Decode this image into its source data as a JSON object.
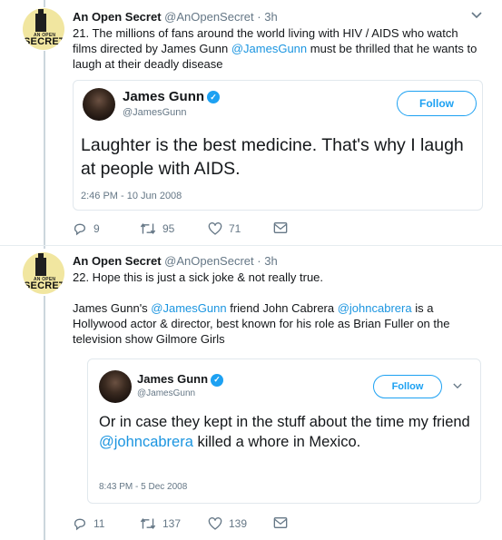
{
  "tweets": [
    {
      "author_name": "An Open Secret",
      "author_handle": "@AnOpenSecret",
      "separator": "·",
      "time": "3h",
      "avatar_subtext": "AN OPEN",
      "avatar_text": "SECRET",
      "text_parts": [
        "21. The millions of fans around the world living with HIV / AIDS who watch films directed by James Gunn ",
        "@JamesGunn",
        " must be thrilled that he wants to laugh at their deadly disease"
      ],
      "quote": {
        "name": "James Gunn",
        "handle": "@JamesGunn",
        "follow_label": "Follow",
        "text": "Laughter is the best medicine.  That's why I laugh at people with AIDS.",
        "timestamp": "2:46 PM - 10 Jun 2008"
      },
      "stats": {
        "replies": "9",
        "retweets": "95",
        "likes": "71"
      }
    },
    {
      "author_name": "An Open Secret",
      "author_handle": "@AnOpenSecret",
      "separator": "·",
      "time": "3h",
      "avatar_subtext": "AN OPEN",
      "avatar_text": "SECRET",
      "line1": "22. Hope this is just a sick joke & not really true.",
      "text_parts": [
        "James Gunn's ",
        "@JamesGunn",
        " friend John Cabrera ",
        "@johncabrera",
        " is a Hollywood actor & director, best known for his role as Brian Fuller on the television show Gilmore Girls"
      ],
      "quote": {
        "name": "James Gunn",
        "handle": "@JamesGunn",
        "follow_label": "Follow",
        "text_before": "Or in case they kept in the stuff about the time my friend ",
        "mention": "@johncabrera",
        "text_after": " killed a whore in Mexico.",
        "timestamp": "8:43 PM - 5 Dec 2008"
      },
      "stats": {
        "replies": "11",
        "retweets": "137",
        "likes": "139"
      }
    }
  ],
  "colors": {
    "link": "#1b95e0",
    "verified": "#1da1f2",
    "muted": "#657786"
  },
  "icons": [
    "reply-icon",
    "retweet-icon",
    "like-icon",
    "message-icon",
    "verified-icon",
    "chevron-down-icon"
  ]
}
